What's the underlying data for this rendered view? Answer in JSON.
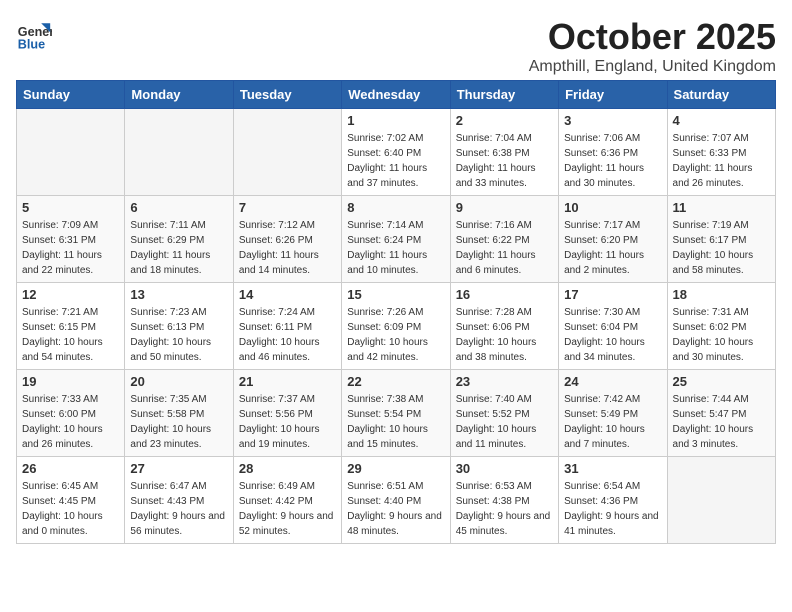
{
  "logo": {
    "general": "General",
    "blue": "Blue"
  },
  "title": "October 2025",
  "subtitle": "Ampthill, England, United Kingdom",
  "days_of_week": [
    "Sunday",
    "Monday",
    "Tuesday",
    "Wednesday",
    "Thursday",
    "Friday",
    "Saturday"
  ],
  "weeks": [
    [
      {
        "day": "",
        "info": ""
      },
      {
        "day": "",
        "info": ""
      },
      {
        "day": "",
        "info": ""
      },
      {
        "day": "1",
        "info": "Sunrise: 7:02 AM\nSunset: 6:40 PM\nDaylight: 11 hours and 37 minutes."
      },
      {
        "day": "2",
        "info": "Sunrise: 7:04 AM\nSunset: 6:38 PM\nDaylight: 11 hours and 33 minutes."
      },
      {
        "day": "3",
        "info": "Sunrise: 7:06 AM\nSunset: 6:36 PM\nDaylight: 11 hours and 30 minutes."
      },
      {
        "day": "4",
        "info": "Sunrise: 7:07 AM\nSunset: 6:33 PM\nDaylight: 11 hours and 26 minutes."
      }
    ],
    [
      {
        "day": "5",
        "info": "Sunrise: 7:09 AM\nSunset: 6:31 PM\nDaylight: 11 hours and 22 minutes."
      },
      {
        "day": "6",
        "info": "Sunrise: 7:11 AM\nSunset: 6:29 PM\nDaylight: 11 hours and 18 minutes."
      },
      {
        "day": "7",
        "info": "Sunrise: 7:12 AM\nSunset: 6:26 PM\nDaylight: 11 hours and 14 minutes."
      },
      {
        "day": "8",
        "info": "Sunrise: 7:14 AM\nSunset: 6:24 PM\nDaylight: 11 hours and 10 minutes."
      },
      {
        "day": "9",
        "info": "Sunrise: 7:16 AM\nSunset: 6:22 PM\nDaylight: 11 hours and 6 minutes."
      },
      {
        "day": "10",
        "info": "Sunrise: 7:17 AM\nSunset: 6:20 PM\nDaylight: 11 hours and 2 minutes."
      },
      {
        "day": "11",
        "info": "Sunrise: 7:19 AM\nSunset: 6:17 PM\nDaylight: 10 hours and 58 minutes."
      }
    ],
    [
      {
        "day": "12",
        "info": "Sunrise: 7:21 AM\nSunset: 6:15 PM\nDaylight: 10 hours and 54 minutes."
      },
      {
        "day": "13",
        "info": "Sunrise: 7:23 AM\nSunset: 6:13 PM\nDaylight: 10 hours and 50 minutes."
      },
      {
        "day": "14",
        "info": "Sunrise: 7:24 AM\nSunset: 6:11 PM\nDaylight: 10 hours and 46 minutes."
      },
      {
        "day": "15",
        "info": "Sunrise: 7:26 AM\nSunset: 6:09 PM\nDaylight: 10 hours and 42 minutes."
      },
      {
        "day": "16",
        "info": "Sunrise: 7:28 AM\nSunset: 6:06 PM\nDaylight: 10 hours and 38 minutes."
      },
      {
        "day": "17",
        "info": "Sunrise: 7:30 AM\nSunset: 6:04 PM\nDaylight: 10 hours and 34 minutes."
      },
      {
        "day": "18",
        "info": "Sunrise: 7:31 AM\nSunset: 6:02 PM\nDaylight: 10 hours and 30 minutes."
      }
    ],
    [
      {
        "day": "19",
        "info": "Sunrise: 7:33 AM\nSunset: 6:00 PM\nDaylight: 10 hours and 26 minutes."
      },
      {
        "day": "20",
        "info": "Sunrise: 7:35 AM\nSunset: 5:58 PM\nDaylight: 10 hours and 23 minutes."
      },
      {
        "day": "21",
        "info": "Sunrise: 7:37 AM\nSunset: 5:56 PM\nDaylight: 10 hours and 19 minutes."
      },
      {
        "day": "22",
        "info": "Sunrise: 7:38 AM\nSunset: 5:54 PM\nDaylight: 10 hours and 15 minutes."
      },
      {
        "day": "23",
        "info": "Sunrise: 7:40 AM\nSunset: 5:52 PM\nDaylight: 10 hours and 11 minutes."
      },
      {
        "day": "24",
        "info": "Sunrise: 7:42 AM\nSunset: 5:49 PM\nDaylight: 10 hours and 7 minutes."
      },
      {
        "day": "25",
        "info": "Sunrise: 7:44 AM\nSunset: 5:47 PM\nDaylight: 10 hours and 3 minutes."
      }
    ],
    [
      {
        "day": "26",
        "info": "Sunrise: 6:45 AM\nSunset: 4:45 PM\nDaylight: 10 hours and 0 minutes."
      },
      {
        "day": "27",
        "info": "Sunrise: 6:47 AM\nSunset: 4:43 PM\nDaylight: 9 hours and 56 minutes."
      },
      {
        "day": "28",
        "info": "Sunrise: 6:49 AM\nSunset: 4:42 PM\nDaylight: 9 hours and 52 minutes."
      },
      {
        "day": "29",
        "info": "Sunrise: 6:51 AM\nSunset: 4:40 PM\nDaylight: 9 hours and 48 minutes."
      },
      {
        "day": "30",
        "info": "Sunrise: 6:53 AM\nSunset: 4:38 PM\nDaylight: 9 hours and 45 minutes."
      },
      {
        "day": "31",
        "info": "Sunrise: 6:54 AM\nSunset: 4:36 PM\nDaylight: 9 hours and 41 minutes."
      },
      {
        "day": "",
        "info": ""
      }
    ]
  ]
}
